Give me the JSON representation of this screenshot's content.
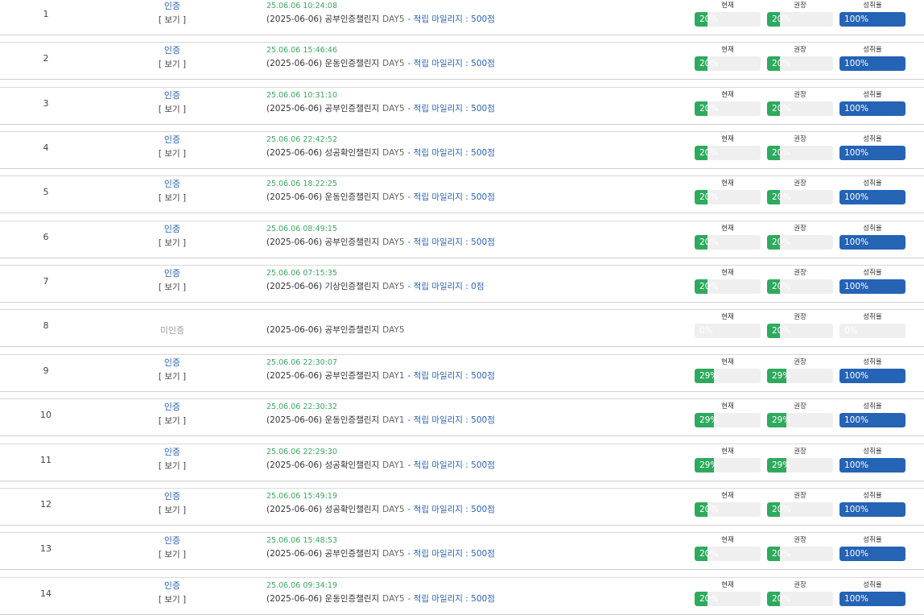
{
  "labels": {
    "current": "현재",
    "recommended": "권장",
    "achievement": "성취율",
    "view": "[ 보기 ]"
  },
  "colors": {
    "green": "#2eaa5e",
    "blue": "#2563b5",
    "link": "#2a63b8",
    "timestamp": "#3aa860",
    "track": "#efefef"
  },
  "rows": [
    {
      "num": "1",
      "status": "인증",
      "auth": true,
      "timestamp": "25.06.06 10:24:08",
      "desc": "(2025-06-06) 공부인증챌린지",
      "day": "DAY5",
      "mileage": "- 적립 마일리지 : 500점",
      "current": "20%",
      "current_pct": 20,
      "recommended": "20%",
      "recommended_pct": 20,
      "achievement": "100%",
      "achievement_pct": 100
    },
    {
      "num": "2",
      "status": "인증",
      "auth": true,
      "timestamp": "25.06.06 15:46:46",
      "desc": "(2025-06-06) 운동인증챌린지",
      "day": "DAY5",
      "mileage": "- 적립 마일리지 : 500점",
      "current": "20%",
      "current_pct": 20,
      "recommended": "20%",
      "recommended_pct": 20,
      "achievement": "100%",
      "achievement_pct": 100
    },
    {
      "num": "3",
      "status": "인증",
      "auth": true,
      "timestamp": "25.06.06 10:31:10",
      "desc": "(2025-06-06) 공부인증챌린지",
      "day": "DAY5",
      "mileage": "- 적립 마일리지 : 500점",
      "current": "20%",
      "current_pct": 20,
      "recommended": "20%",
      "recommended_pct": 20,
      "achievement": "100%",
      "achievement_pct": 100
    },
    {
      "num": "4",
      "status": "인증",
      "auth": true,
      "timestamp": "25.06.06 22:42:52",
      "desc": "(2025-06-06) 성공확인챌린지",
      "day": "DAY5",
      "mileage": "- 적립 마일리지 : 500점",
      "current": "20%",
      "current_pct": 20,
      "recommended": "20%",
      "recommended_pct": 20,
      "achievement": "100%",
      "achievement_pct": 100
    },
    {
      "num": "5",
      "status": "인증",
      "auth": true,
      "timestamp": "25.06.06 18:22:25",
      "desc": "(2025-06-06) 운동인증챌린지",
      "day": "DAY5",
      "mileage": "- 적립 마일리지 : 500점",
      "current": "20%",
      "current_pct": 20,
      "recommended": "20%",
      "recommended_pct": 20,
      "achievement": "100%",
      "achievement_pct": 100
    },
    {
      "num": "6",
      "status": "인증",
      "auth": true,
      "timestamp": "25.06.06 08:49:15",
      "desc": "(2025-06-06) 공부인증챌린지",
      "day": "DAY5",
      "mileage": "- 적립 마일리지 : 500점",
      "current": "20%",
      "current_pct": 20,
      "recommended": "20%",
      "recommended_pct": 20,
      "achievement": "100%",
      "achievement_pct": 100
    },
    {
      "num": "7",
      "status": "인증",
      "auth": true,
      "timestamp": "25.06.06 07:15:35",
      "desc": "(2025-06-06) 기상인증챌린지",
      "day": "DAY5",
      "mileage": "- 적립 마일리지 : 0점",
      "current": "20%",
      "current_pct": 20,
      "recommended": "20%",
      "recommended_pct": 20,
      "achievement": "100%",
      "achievement_pct": 100
    },
    {
      "num": "8",
      "status": "미인증",
      "auth": false,
      "timestamp": "",
      "desc": "(2025-06-06) 공부인증챌린지",
      "day": "DAY5",
      "mileage": "",
      "current": "0%",
      "current_pct": 0,
      "recommended": "20%",
      "recommended_pct": 20,
      "achievement": "0%",
      "achievement_pct": 0
    },
    {
      "num": "9",
      "status": "인증",
      "auth": true,
      "timestamp": "25.06.06 22:30:07",
      "desc": "(2025-06-06) 공부인증챌린지",
      "day": "DAY1",
      "mileage": "- 적립 마일리지 : 500점",
      "current": "29%",
      "current_pct": 29,
      "recommended": "29%",
      "recommended_pct": 29,
      "achievement": "100%",
      "achievement_pct": 100
    },
    {
      "num": "10",
      "status": "인증",
      "auth": true,
      "timestamp": "25.06.06 22:30:32",
      "desc": "(2025-06-06) 운동인증챌린지",
      "day": "DAY1",
      "mileage": "- 적립 마일리지 : 500점",
      "current": "29%",
      "current_pct": 29,
      "recommended": "29%",
      "recommended_pct": 29,
      "achievement": "100%",
      "achievement_pct": 100
    },
    {
      "num": "11",
      "status": "인증",
      "auth": true,
      "timestamp": "25.06.06 22:29:30",
      "desc": "(2025-06-06) 성공확인챌린지",
      "day": "DAY1",
      "mileage": "- 적립 마일리지 : 500점",
      "current": "29%",
      "current_pct": 29,
      "recommended": "29%",
      "recommended_pct": 29,
      "achievement": "100%",
      "achievement_pct": 100
    },
    {
      "num": "12",
      "status": "인증",
      "auth": true,
      "timestamp": "25.06.06 15:49:19",
      "desc": "(2025-06-06) 성공확인챌린지",
      "day": "DAY5",
      "mileage": "- 적립 마일리지 : 500점",
      "current": "20%",
      "current_pct": 20,
      "recommended": "20%",
      "recommended_pct": 20,
      "achievement": "100%",
      "achievement_pct": 100
    },
    {
      "num": "13",
      "status": "인증",
      "auth": true,
      "timestamp": "25.06.06 15:48:53",
      "desc": "(2025-06-06) 공부인증챌린지",
      "day": "DAY5",
      "mileage": "- 적립 마일리지 : 500점",
      "current": "20%",
      "current_pct": 20,
      "recommended": "20%",
      "recommended_pct": 20,
      "achievement": "100%",
      "achievement_pct": 100
    },
    {
      "num": "14",
      "status": "인증",
      "auth": true,
      "timestamp": "25.06.06 09:34:19",
      "desc": "(2025-06-06) 운동인증챌린지",
      "day": "DAY5",
      "mileage": "- 적립 마일리지 : 500점",
      "current": "20%",
      "current_pct": 20,
      "recommended": "20%",
      "recommended_pct": 20,
      "achievement": "100%",
      "achievement_pct": 100
    }
  ]
}
